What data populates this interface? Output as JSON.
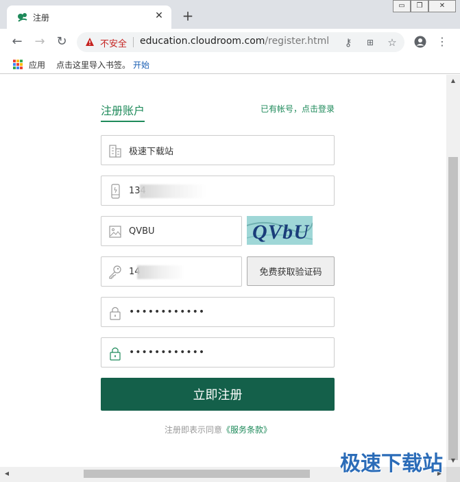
{
  "browser": {
    "tab_title": "注册",
    "new_tab_symbol": "+",
    "close_symbol": "✕",
    "security_text": "不安全",
    "url_host": "education.cloudroom.com",
    "url_path": "/register.html",
    "window_controls": [
      "▭",
      "❐",
      "✕"
    ]
  },
  "bookmarks": {
    "apps_label": "应用",
    "import_text": "点击这里导入书签。",
    "start_link": "开始"
  },
  "form": {
    "title": "注册账户",
    "login_link": "已有帐号，点击登录",
    "company_value": "极速下载站",
    "phone_value": "134",
    "captcha_value": "QVBU",
    "captcha_image_text": "QVbU",
    "sms_code_value": "14",
    "sms_button_label": "免费获取验证码",
    "password_value": "••••••••••••",
    "confirm_password_value": "••••••••••••",
    "submit_label": "立即注册",
    "agree_text": "注册即表示同意",
    "terms_link": "《服务条款》"
  },
  "watermark": "极速下载站",
  "colors": {
    "accent": "#1e8a5a",
    "submit_bg": "#14604a",
    "insecure": "#c5221f",
    "watermark": "#2b6cb8"
  },
  "icons": {
    "company": "building-icon",
    "phone": "phone-icon",
    "captcha": "image-icon",
    "sms": "key-icon",
    "password": "lock-icon",
    "confirm": "lock-green-icon"
  }
}
